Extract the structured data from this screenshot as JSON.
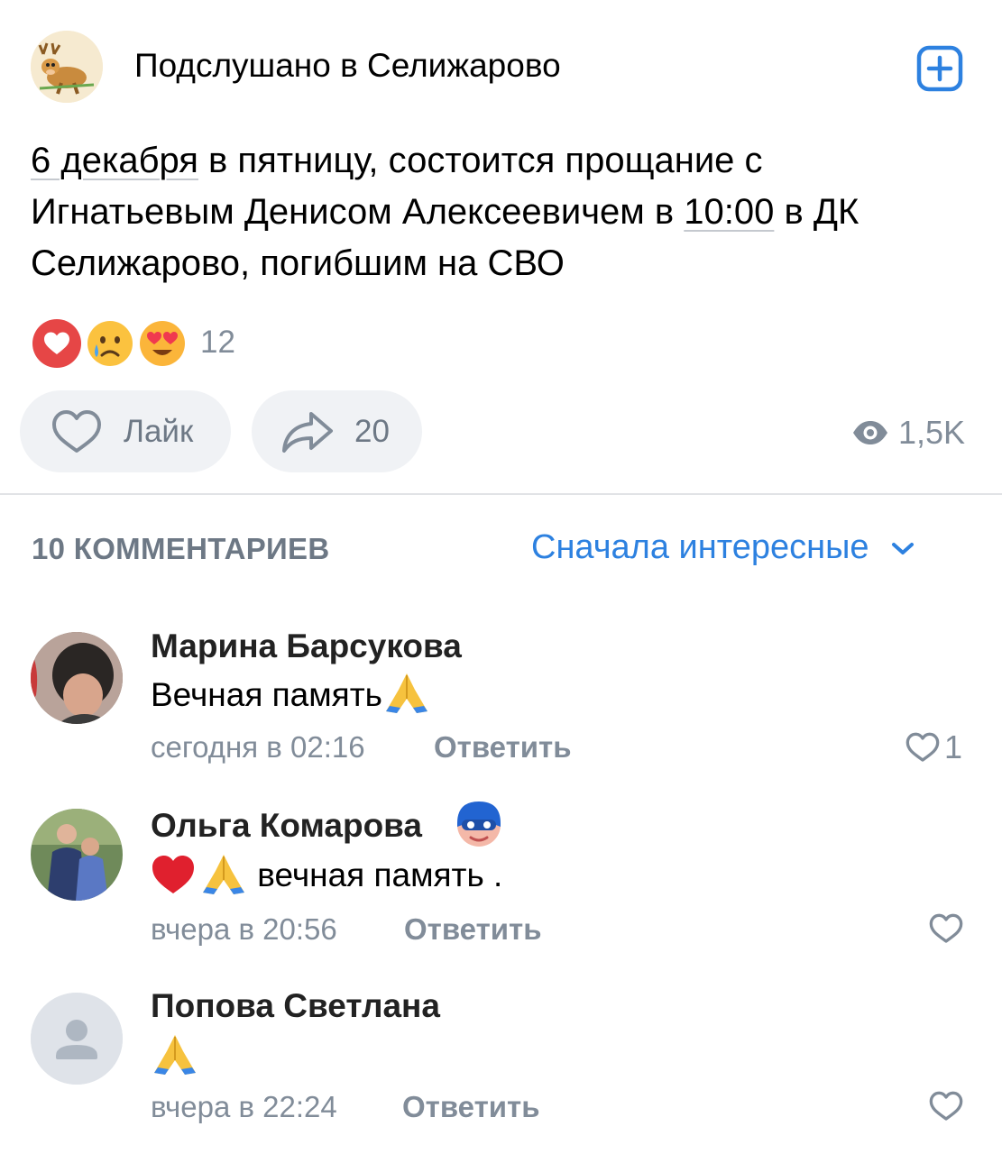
{
  "header": {
    "group_name": "Подслушано в Селижарово"
  },
  "post": {
    "text_part1": "6 декабря",
    "text_part2": " в пятницу, состоится прощание с Игнатьевым Денисом Алексеевичем в ",
    "text_part3": "10:00",
    "text_part4": " в ДК Селижарово, погибшим на СВО",
    "reactions": [
      "heart",
      "crying-face",
      "heart-eyes-face"
    ],
    "reaction_count": "12",
    "like_label": "Лайк",
    "share_count": "20",
    "views": "1,5K"
  },
  "comments_header": {
    "count_label": "10 КОММЕНТАРИЕВ",
    "sort_label": "Сначала интересные"
  },
  "comments": [
    {
      "author": "Марина Барсукова",
      "text": "Вечная память",
      "time": "сегодня в 02:16",
      "reply": "Ответить",
      "likes": "1"
    },
    {
      "author": "Ольга Комарова",
      "text": " вечная память .",
      "time": "вчера в 20:56",
      "reply": "Ответить",
      "likes": ""
    },
    {
      "author": "Попова Светлана",
      "text": "",
      "time": "вчера в 22:24",
      "reply": "Ответить",
      "likes": ""
    }
  ],
  "colors": {
    "accent": "#2d81e0",
    "secondary_text": "#818c99",
    "button_bg": "#f0f2f5",
    "like_red": "#e64646"
  }
}
